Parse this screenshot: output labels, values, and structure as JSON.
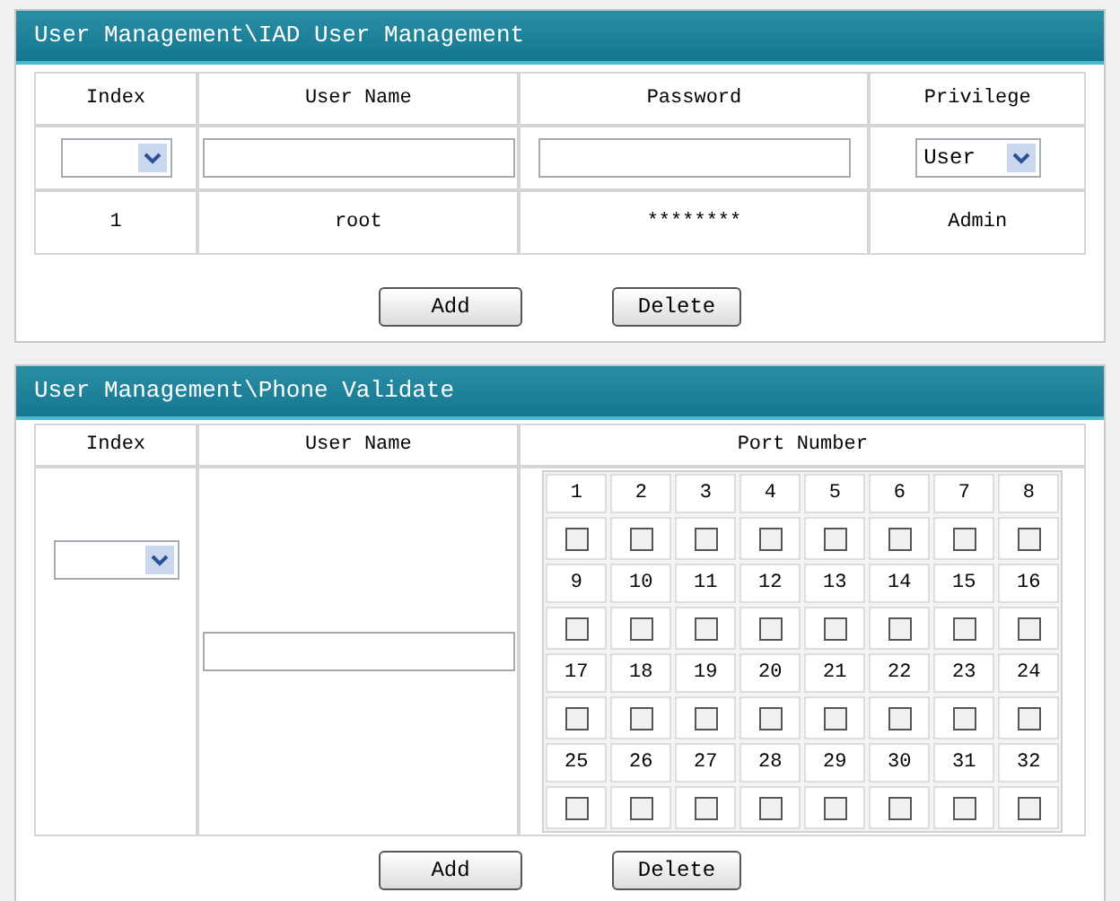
{
  "iad_panel": {
    "title": "User Management\\IAD User Management",
    "columns": [
      "Index",
      "User Name",
      "Password",
      "Privilege"
    ],
    "input_row": {
      "privilege": {
        "value": "User"
      }
    },
    "rows": [
      {
        "index": "1",
        "user_name": "root",
        "password": "********",
        "privilege": "Admin"
      }
    ],
    "buttons": [
      "Add",
      "Delete"
    ]
  },
  "phone_panel": {
    "title": "User Management\\Phone Validate",
    "columns": [
      "Index",
      "User Name",
      "Port Number"
    ],
    "ports": [
      {
        "label": "1",
        "checked": false
      },
      {
        "label": "2",
        "checked": false
      },
      {
        "label": "3",
        "checked": false
      },
      {
        "label": "4",
        "checked": false
      },
      {
        "label": "5",
        "checked": false
      },
      {
        "label": "6",
        "checked": false
      },
      {
        "label": "7",
        "checked": false
      },
      {
        "label": "8",
        "checked": false
      },
      {
        "label": "9",
        "checked": false
      },
      {
        "label": "10",
        "checked": false
      },
      {
        "label": "11",
        "checked": false
      },
      {
        "label": "12",
        "checked": false
      },
      {
        "label": "13",
        "checked": false
      },
      {
        "label": "14",
        "checked": false
      },
      {
        "label": "15",
        "checked": false
      },
      {
        "label": "16",
        "checked": false
      },
      {
        "label": "17",
        "checked": false
      },
      {
        "label": "18",
        "checked": false
      },
      {
        "label": "19",
        "checked": false
      },
      {
        "label": "20",
        "checked": false
      },
      {
        "label": "21",
        "checked": false
      },
      {
        "label": "22",
        "checked": false
      },
      {
        "label": "23",
        "checked": false
      },
      {
        "label": "24",
        "checked": false
      },
      {
        "label": "25",
        "checked": false
      },
      {
        "label": "26",
        "checked": false
      },
      {
        "label": "27",
        "checked": false
      },
      {
        "label": "28",
        "checked": false
      },
      {
        "label": "29",
        "checked": false
      },
      {
        "label": "30",
        "checked": false
      },
      {
        "label": "31",
        "checked": false
      },
      {
        "label": "32",
        "checked": false
      }
    ],
    "buttons": [
      "Add",
      "Delete"
    ]
  }
}
